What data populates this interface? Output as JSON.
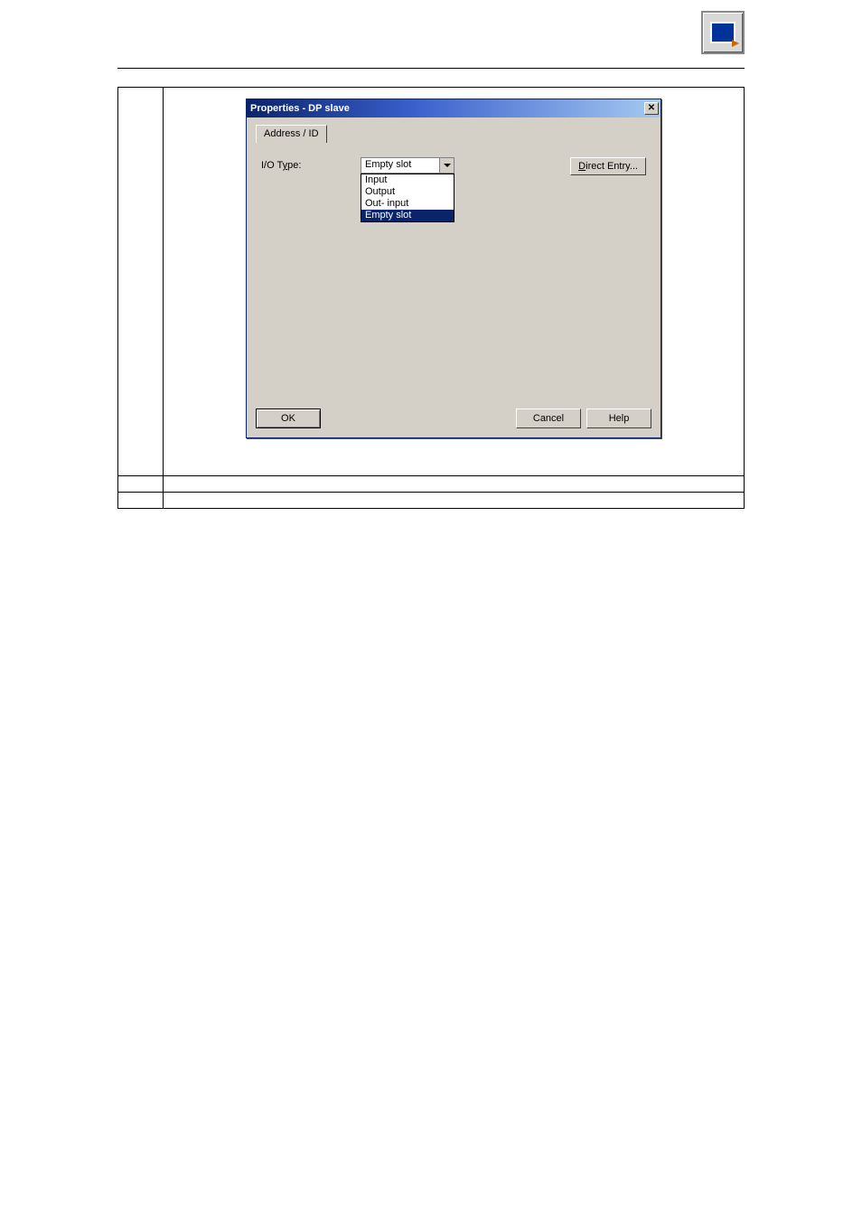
{
  "dialog": {
    "title": "Properties - DP slave",
    "tab_label": "Address / ID",
    "io_type_label_prefix": "I/O T",
    "io_type_label_underlined": "y",
    "io_type_label_suffix": "pe:",
    "combo_selected": "Empty slot",
    "combo_options": [
      "Input",
      "Output",
      "Out- input",
      "Empty slot"
    ],
    "direct_entry_underlined": "D",
    "direct_entry_rest": "irect Entry...",
    "ok": "OK",
    "cancel": "Cancel",
    "help": "Help"
  }
}
